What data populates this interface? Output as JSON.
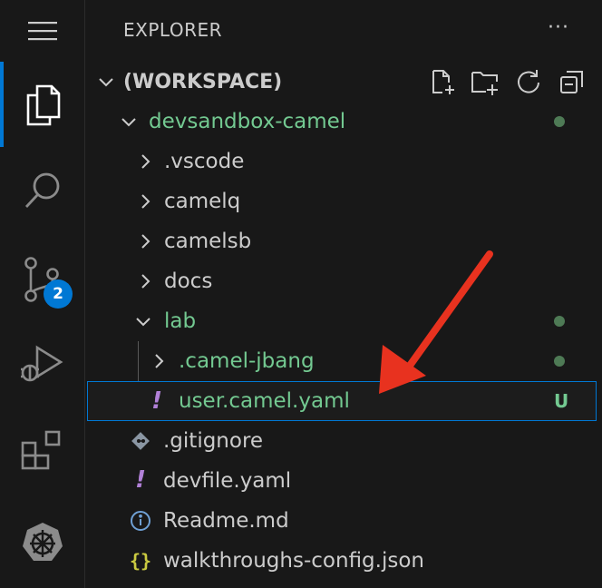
{
  "activity_bar": {
    "items": [
      {
        "name": "explorer",
        "icon": "files-icon",
        "active": true
      },
      {
        "name": "search",
        "icon": "search-icon"
      },
      {
        "name": "source-control",
        "icon": "source-control-icon",
        "badge": "2"
      },
      {
        "name": "run-debug",
        "icon": "run-debug-icon"
      },
      {
        "name": "extensions",
        "icon": "extensions-icon"
      },
      {
        "name": "kubernetes",
        "icon": "kubernetes-icon"
      }
    ],
    "accent": "#0078d4"
  },
  "explorer": {
    "title": "EXPLORER",
    "more_actions": "···",
    "workspace_label": "(WORKSPACE)",
    "workspace_actions": [
      "new-file-icon",
      "new-folder-icon",
      "refresh-icon",
      "collapse-all-icon"
    ],
    "tree": [
      {
        "label": "devsandbox-camel",
        "type": "folder",
        "expanded": true,
        "color": "#73c991",
        "status": "dot"
      },
      {
        "label": ".vscode",
        "type": "folder",
        "expanded": false
      },
      {
        "label": "camelq",
        "type": "folder",
        "expanded": false
      },
      {
        "label": "camelsb",
        "type": "folder",
        "expanded": false
      },
      {
        "label": "docs",
        "type": "folder",
        "expanded": false
      },
      {
        "label": "lab",
        "type": "folder",
        "expanded": true,
        "color": "#73c991",
        "status": "dot"
      },
      {
        "label": ".camel-jbang",
        "type": "folder",
        "expanded": false,
        "color": "#73c991",
        "status": "dot"
      },
      {
        "label": "user.camel.yaml",
        "type": "file",
        "icon": "yaml-icon",
        "color": "#73c991",
        "status": "U",
        "selected": true
      },
      {
        "label": ".gitignore",
        "type": "file",
        "icon": "git-icon"
      },
      {
        "label": "devfile.yaml",
        "type": "file",
        "icon": "yaml-icon"
      },
      {
        "label": "Readme.md",
        "type": "file",
        "icon": "info-icon"
      },
      {
        "label": "walkthroughs-config.json",
        "type": "file",
        "icon": "json-icon"
      }
    ]
  },
  "annotation": {
    "type": "red-arrow",
    "color": "#e8321f"
  }
}
